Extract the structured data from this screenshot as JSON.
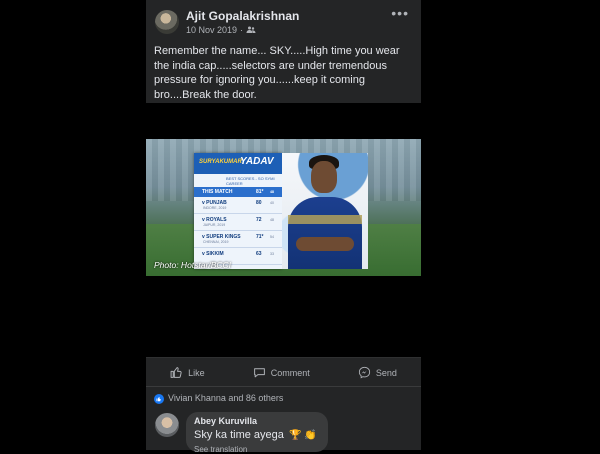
{
  "post": {
    "author": "Ajit Gopalakrishnan",
    "date": "10 Nov 2019",
    "audience_icon": "friends-icon",
    "more_label": "•••",
    "text": "Remember the name... SKY.....High time you wear\nthe india cap.....selectors are under tremendous\npressure for ignoring you......keep it coming\nbro....Break the door."
  },
  "image": {
    "caption": "Photo: Hotstar/BCCI",
    "card": {
      "first_name": "SURYAKUMAR",
      "last_name": "YADAV",
      "subtitle": "BEST SCORES - SO SYMI CAREER",
      "this_match_label": "THIS MATCH",
      "this_match_value": "81*",
      "this_match_balls": "48",
      "rows": [
        {
          "team": "v PUNJAB",
          "sub": "INDORE, 2019",
          "score": "80",
          "balls": "40"
        },
        {
          "team": "v ROYALS",
          "sub": "JAIPUR, 2019",
          "score": "72",
          "balls": "48"
        },
        {
          "team": "v SUPER KINGS",
          "sub": "CHENNAI, 2019",
          "score": "71*",
          "balls": "54"
        },
        {
          "team": "v SIKKIM",
          "sub": "",
          "score": "63",
          "balls": "33"
        }
      ]
    }
  },
  "actions": {
    "like": "Like",
    "comment": "Comment",
    "send": "Send"
  },
  "reactions": {
    "text": "Vivian Khanna and 86 others"
  },
  "comment": {
    "author": "Abey Kuruvilla",
    "text": "Sky ka time ayega",
    "emojis": "🏆 👏",
    "translation": "See translation"
  },
  "colors": {
    "background": "#000000",
    "card": "#242526",
    "text": "#e4e6eb",
    "muted": "#b0b3b8",
    "accent": "#1877f2"
  }
}
